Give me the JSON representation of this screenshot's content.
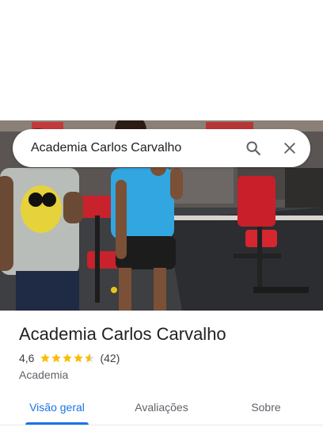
{
  "search": {
    "query": "Academia Carlos Carvalho",
    "search_icon": "search-icon",
    "close_icon": "close-icon"
  },
  "place": {
    "name": "Academia Carlos Carvalho",
    "rating": "4,6",
    "rating_value": 4.6,
    "review_count": "(42)",
    "category": "Academia"
  },
  "tabs": [
    {
      "label": "Visão geral",
      "active": true
    },
    {
      "label": "Avaliações",
      "active": false
    },
    {
      "label": "Sobre",
      "active": false
    }
  ],
  "colors": {
    "accent": "#1a73e8",
    "star": "#fbbc04",
    "text_primary": "#202124",
    "text_secondary": "#5f6368"
  }
}
